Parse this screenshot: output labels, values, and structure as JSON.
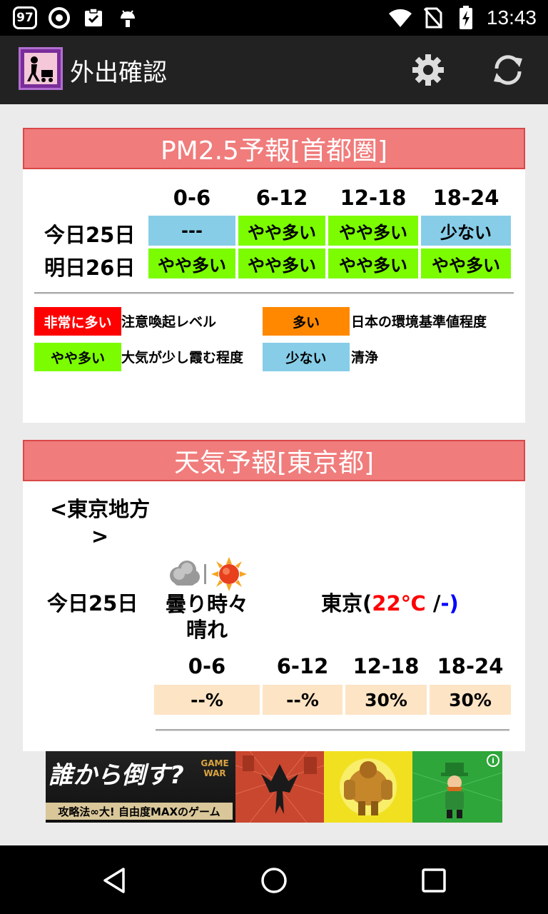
{
  "status_bar": {
    "notification_count": "97",
    "time": "13:43",
    "icons": [
      "notification-count-icon",
      "aeon-icon",
      "clipboard-check-icon",
      "android-icon",
      "wifi-icon",
      "no-sim-icon",
      "battery-charging-icon"
    ]
  },
  "action_bar": {
    "title": "外出確認",
    "icons": [
      "app-icon",
      "settings-gear-icon",
      "refresh-icon"
    ]
  },
  "pm25": {
    "header": "PM2.5予報[首都圏]",
    "time_slots": [
      "0-6",
      "6-12",
      "12-18",
      "18-24"
    ],
    "rows": [
      {
        "day": "今日25日",
        "cells": [
          {
            "label": "---",
            "level": "blue"
          },
          {
            "label": "やや多い",
            "level": "green"
          },
          {
            "label": "やや多い",
            "level": "green"
          },
          {
            "label": "少ない",
            "level": "blue"
          }
        ]
      },
      {
        "day": "明日26日",
        "cells": [
          {
            "label": "やや多い",
            "level": "green"
          },
          {
            "label": "やや多い",
            "level": "green"
          },
          {
            "label": "やや多い",
            "level": "green"
          },
          {
            "label": "やや多い",
            "level": "green"
          }
        ]
      }
    ],
    "legend": [
      {
        "label": "非常に多い",
        "desc": "注意喚起レベル",
        "color": "#ff0000"
      },
      {
        "label": "多い",
        "desc": "日本の環境基準値程度",
        "color": "#ff8800"
      },
      {
        "label": "やや多い",
        "desc": "大気が少し霞む程度",
        "color": "#7cfc00"
      },
      {
        "label": "少ない",
        "desc": "清浄",
        "color": "#87cde8"
      }
    ]
  },
  "weather": {
    "header": "天気予報[東京都]",
    "region": "<東京地方>",
    "day": "今日25日",
    "forecast": "曇り時々晴れ",
    "forecast_icons": [
      "cloud-icon",
      "sun-icon"
    ],
    "city": "東京",
    "temp_open": "(",
    "temp_max": "22℃",
    "temp_sep": " /",
    "temp_min": "-",
    "temp_close": ")",
    "time_slots": [
      "0-6",
      "6-12",
      "12-18",
      "18-24"
    ],
    "rain_chance": [
      "--%",
      "--%",
      "30%",
      "30%"
    ]
  },
  "ad": {
    "headline": "誰から倒す?",
    "logo": "GAME WAR",
    "subline": "攻略法∞大! 自由度MAXのゲーム",
    "info_icon": "i"
  },
  "nav_bar": {
    "icons": [
      "back-icon",
      "home-icon",
      "recents-icon"
    ]
  }
}
